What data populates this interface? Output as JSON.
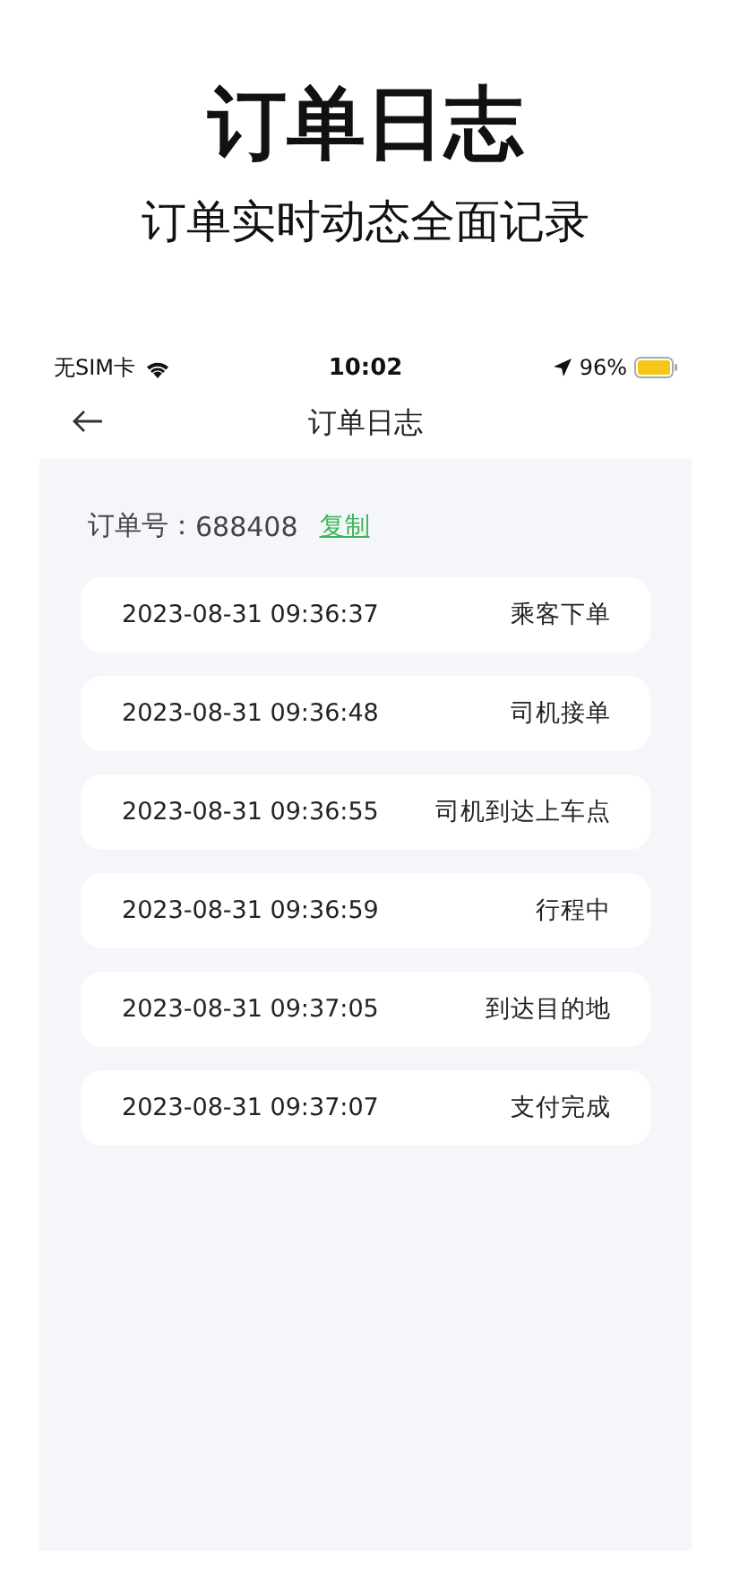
{
  "headline": {
    "title": "订单日志",
    "subtitle": "订单实时动态全面记录"
  },
  "status_bar": {
    "carrier": "无SIM卡",
    "time": "10:02",
    "battery": "96%"
  },
  "nav": {
    "title": "订单日志"
  },
  "order": {
    "label": "订单号：",
    "number": "688408",
    "copy": "复制"
  },
  "logs": [
    {
      "time": "2023-08-31 09:36:37",
      "event": "乘客下单"
    },
    {
      "time": "2023-08-31 09:36:48",
      "event": "司机接单"
    },
    {
      "time": "2023-08-31 09:36:55",
      "event": "司机到达上车点"
    },
    {
      "time": "2023-08-31 09:36:59",
      "event": "行程中"
    },
    {
      "time": "2023-08-31 09:37:05",
      "event": "到达目的地"
    },
    {
      "time": "2023-08-31 09:37:07",
      "event": "支付完成"
    }
  ]
}
